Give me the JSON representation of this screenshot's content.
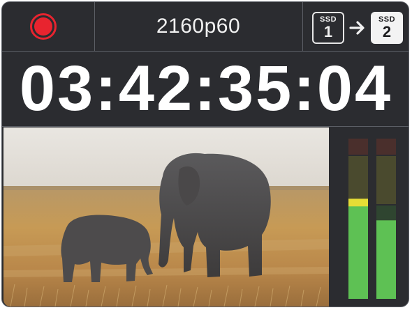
{
  "record": {
    "icon": "record-icon",
    "color": "#e8242f"
  },
  "format": {
    "label": "2160p60"
  },
  "storage": {
    "source": {
      "caption": "SSD",
      "number": "1"
    },
    "target": {
      "caption": "SSD",
      "number": "2"
    }
  },
  "timecode": "03:42:35:04",
  "preview": {
    "subject": "Two elephants walking across golden savanna grassland"
  },
  "audio_meters": [
    {
      "level": 0.58,
      "peak": 0.625
    },
    {
      "level": 0.49
    }
  ],
  "colors": {
    "panel": "#2b2c30",
    "meter_green": "#5ec154",
    "meter_yellow": "#e6dd36",
    "meter_red_dim": "#4a2f2c"
  }
}
